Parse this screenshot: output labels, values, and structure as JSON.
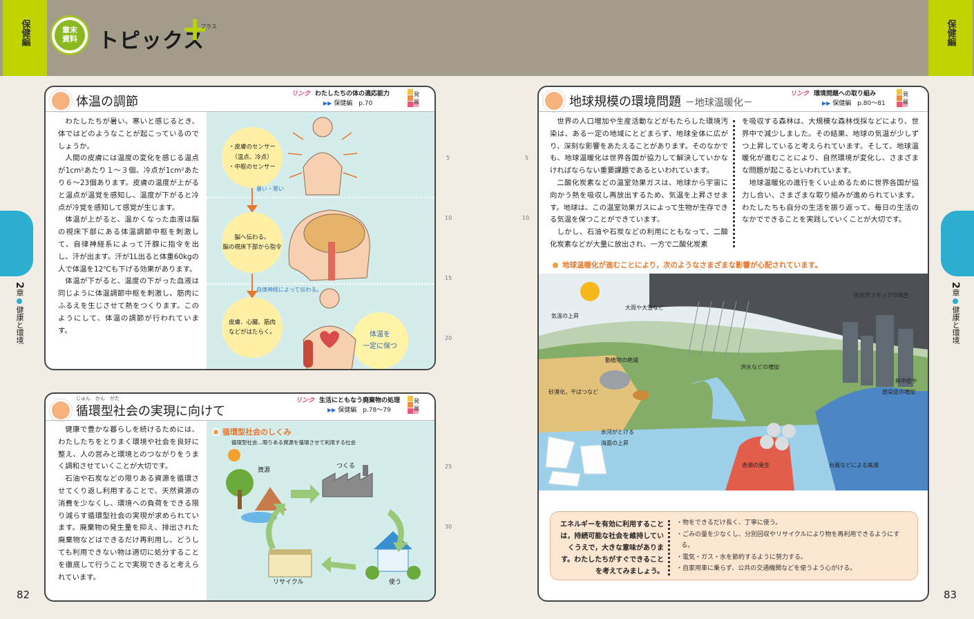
{
  "header": {
    "genre_left": "保健編",
    "genre_right": "保健編",
    "badge_line1": "章末",
    "badge_line2": "資料",
    "title": "トピックス",
    "plus_ruby": "プラス"
  },
  "chapter_tab": {
    "num": "2",
    "unit": "章",
    "label": "健康と環境"
  },
  "pages": {
    "left": "82",
    "right": "83"
  },
  "line_numbers": [
    "5",
    "10",
    "15",
    "20",
    "25",
    "30"
  ],
  "sec_body_temp": {
    "title": "体温の調節",
    "link_label": "リンク",
    "link_title": "わたしたちの体の適応能力",
    "link_ref": "保健編",
    "link_page": "p.70",
    "hatten": [
      "発",
      "展"
    ],
    "paragraphs": [
      "わたしたちが暑い、寒いと感じるとき、体ではどのようなことが起こっているのでしょうか。",
      "人間の皮膚には温度の変化を感じる温点が1cm²あたり１～３個、冷点が1cm²あたり６～23個あります。皮膚の温度が上がると温点が温覚を感知し、温度が下がると冷点が冷覚を感知して感覚が生じます。",
      "体温が上がると、温かくなった血液は脳の視床下部にある体温調節中枢を刺激して、自律神経系によって汗腺に指令を出し、汗が出ます。汗が1L出ると体重60kgの人で体温を12℃も下げる効果があります。",
      "体温が下がると、温度の下がった血液は同じように体温調節中枢を刺激し、筋肉にふるえを生じさせて熱をつくります。このようにして、体温の調節が行われています。"
    ],
    "fig": {
      "c1_l1": "・皮膚のセンサー",
      "c1_l2": "（温点、冷点）",
      "c1_l3": "・中枢のセンサー",
      "arrow1": "暑い・寒い",
      "c2_l1": "脳へ伝わる。",
      "c2_l2": "脳の視床下部から指令",
      "arrow2": "自律神経によって伝わる。",
      "c3_l1": "皮膚、心臓、筋肉",
      "c3_l2": "などがはたらく。",
      "c4_l1": "体温を",
      "c4_l2": "一定に保つ"
    }
  },
  "sec_recycle": {
    "title": "循環型社会の実現に向けて",
    "title_ruby": "じゅん　かん　がた",
    "link_label": "リンク",
    "link_title": "生活にともなう廃棄物の処理",
    "link_ref": "保健編",
    "link_page": "p.78～79",
    "hatten": [
      "発",
      "展"
    ],
    "paragraphs": [
      "健康で豊かな暮らしを続けるためには、わたしたちをとりまく環境や社会を良好に整え、人の営みと環境とのつながりをうまく調和させていくことが大切です。",
      "石油や石炭などの限りある資源を循環させてくり返し利用することで、天然資源の消費を少なくし、環境への負荷をできる限り減らす循環型社会の実現が求められています。廃棄物の発生量を抑え、排出された廃棄物などはできるだけ再利用し、どうしても利用できない物は適切に処分することを徹底して行うことで実現できると考えられています。"
    ],
    "fig_heading": "循環型社会のしくみ",
    "fig_def": "循環型社会…限りある資源を循環させて利用する社会",
    "fig_labels": {
      "shigen": "資源",
      "tsukuru": "つくる",
      "tsukau": "使う",
      "recycle": "リサイクル"
    }
  },
  "sec_global": {
    "title": "地球規模の環境問題",
    "subtitle": "－地球温暖化－",
    "link_label": "リンク",
    "link_title": "環境問題への取り組み",
    "link_ref": "保健編",
    "link_page": "p.80～81",
    "hatten": [
      "発",
      "展"
    ],
    "col1": [
      "世界の人口増加や生産活動などがもたらした環境汚染は、ある一定の地域にとどまらず、地球全体に広がり、深刻な影響をあたえることがあります。そのなかでも、地球温暖化は世界各国が協力して解決していかなければならない重要課題であるといわれています。",
      "二酸化炭素などの温室効果ガスは、地球から宇宙に向かう熱を吸収し再放出するため、気温を上昇させます。地球は、この温室効果ガスによって生物が生存できる気温を保つことができています。",
      "しかし、石油や石炭などの利用にともなって、二酸化炭素などが大量に放出され、一方で二酸化炭素"
    ],
    "col2": [
      "を吸収する森林は、大規模な森林伐採などにより、世界中で減少しました。その結果、地球の気温が少しずつ上昇していると考えられています。そして、地球温暖化が進むことにより、自然環境が変化し、さまざまな問題が起こるといわれています。",
      "地球温暖化の進行をくい止めるために世界各国が協力し合い、さまざまな取り組みが進められています。わたしたちも自分の生活を振り返って、毎日の生活のなかでできることを実践していくことが大切です。"
    ],
    "illus_heading": "地球温暖化が進むことにより，次のようなさまざまな影響が心配されています。",
    "illus_labels": {
      "temp": "気温の上昇",
      "rain": "大雨や大雪など",
      "smog": "光化学スモッグの発生",
      "extinct": "動植物の絶滅",
      "flood": "洪水などの増加",
      "heat1": "熱中症や",
      "heat2": "感染症の増加",
      "desert": "砂漠化，干ばつなど",
      "glacier1": "氷河がとける",
      "glacier2": "海面の上昇",
      "redtide": "赤潮の発生",
      "storm": "台風などによる高潮"
    },
    "energy_left": "エネルギーを有効に利用することは，持続可能な社会を維持していくうえで，大きな意味があります。わたしたちがすぐできることを考えてみましょう。",
    "energy_items": [
      "・物をできるだけ長く、丁寧に使う。",
      "・ごみの量を少なくし、分別回収やリサイクルにより物を再利用できるようにする。",
      "・電気・ガス・水を節約するように努力する。",
      "・自家用車に乗らず、公共の交通機関などを使うよう心がける。"
    ]
  },
  "colors": {
    "header": "#a39c8b",
    "lime": "#c2d400",
    "tab": "#2baed0",
    "figbg": "#d4ecea",
    "accent": "#f6b27c"
  }
}
